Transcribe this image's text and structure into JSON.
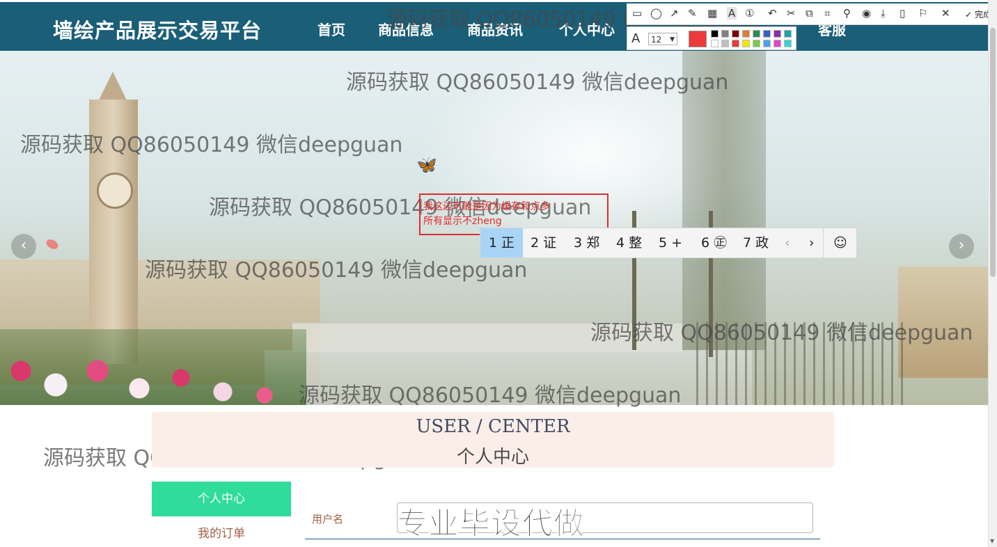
{
  "header": {
    "brand": "墙绘产品展示交易平台",
    "nav": [
      "首页",
      "商品信息",
      "商品资讯",
      "个人中心",
      "客服"
    ],
    "active_nav_index": 3
  },
  "hero": {
    "prev_arrow": "‹",
    "next_arrow": "›",
    "slide_count": 3,
    "active_slide": 1
  },
  "watermarks": [
    "源码获取 QQ86050149 微信deepguan",
    "源码获取 QQ86050149 微信deepguan",
    "源码获取 QQ86050149 微信deepguan",
    "源码获取 QQ86050149 微信deepguan",
    "源码获取 QQ86050149 微信deepguan",
    "源码获取 QQ86050149 微信deepguan",
    "源码获取 QQ86050149 微信deepguan",
    "源码获取 QQ86050149 微信deepguan"
  ],
  "annotation": {
    "line1": "我这边可能是因为缓存和点多",
    "line2": "所有显示不zheng",
    "color": "#e02b2b"
  },
  "ime": {
    "candidates": [
      "1 正",
      "2 证",
      "3 郑",
      "4 整",
      "5 +",
      "6 ㊣",
      "7 政"
    ],
    "selected_index": 0,
    "prev": "‹",
    "next": "›",
    "emoji": "☺"
  },
  "screenshot_toolbar": {
    "tools": [
      "rectangle-icon",
      "ellipse-icon",
      "arrow-icon",
      "pen-icon",
      "mosaic-icon",
      "text-icon",
      "number-icon",
      "undo-icon",
      "cut-icon",
      "translate-icon",
      "ocr-icon",
      "pin-icon",
      "record-icon",
      "download-icon",
      "phone-icon",
      "bookmark-icon",
      "close-icon"
    ],
    "done_label": "完成",
    "font_size": "12",
    "current_color": "#ea3b3b",
    "palette": [
      "#000000",
      "#808080",
      "#800000",
      "#e07b39",
      "#2e8b57",
      "#3b5fc0",
      "#8b2fa0",
      "#1fa3a3",
      "#ffffff",
      "#c0c0c0",
      "#ea3b3b",
      "#f5e600",
      "#7ec850",
      "#4aa3e8",
      "#e046c8",
      "#38d4d4"
    ]
  },
  "user_center": {
    "title_en": "USER / CENTER",
    "title_cn": "个人中心"
  },
  "sidebar": {
    "items": [
      "个人中心",
      "我的订单"
    ],
    "active_index": 0,
    "active_color": "#2fdc9a"
  },
  "form": {
    "username_label": "用户名",
    "username_value": ""
  },
  "overlay_promo": "专业毕设代做"
}
